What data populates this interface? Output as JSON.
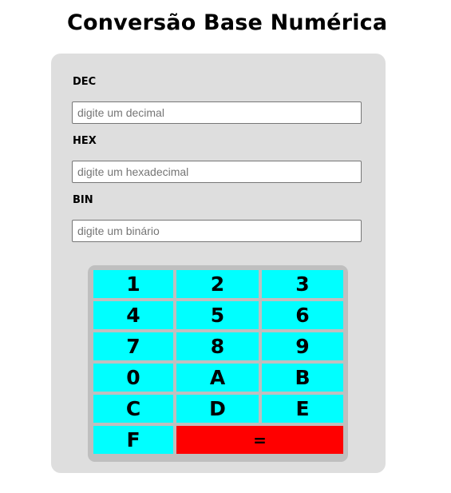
{
  "page": {
    "title": "Conversão Base Numérica"
  },
  "form": {
    "dec": {
      "label": "DEC",
      "value": "",
      "placeholder": "digite um decimal"
    },
    "hex": {
      "label": "HEX",
      "value": "",
      "placeholder": "digite um hexadecimal"
    },
    "bin": {
      "label": "BIN",
      "value": "",
      "placeholder": "digite um binário"
    }
  },
  "keypad": {
    "keys": [
      "1",
      "2",
      "3",
      "4",
      "5",
      "6",
      "7",
      "8",
      "9",
      "0",
      "A",
      "B",
      "C",
      "D",
      "E",
      "F"
    ],
    "equals_label": "=",
    "colors": {
      "key": "#00ffff",
      "equals": "#ff0000",
      "background": "#bfbfbf"
    }
  },
  "colors": {
    "panel": "#dedede",
    "text": "#000000"
  }
}
